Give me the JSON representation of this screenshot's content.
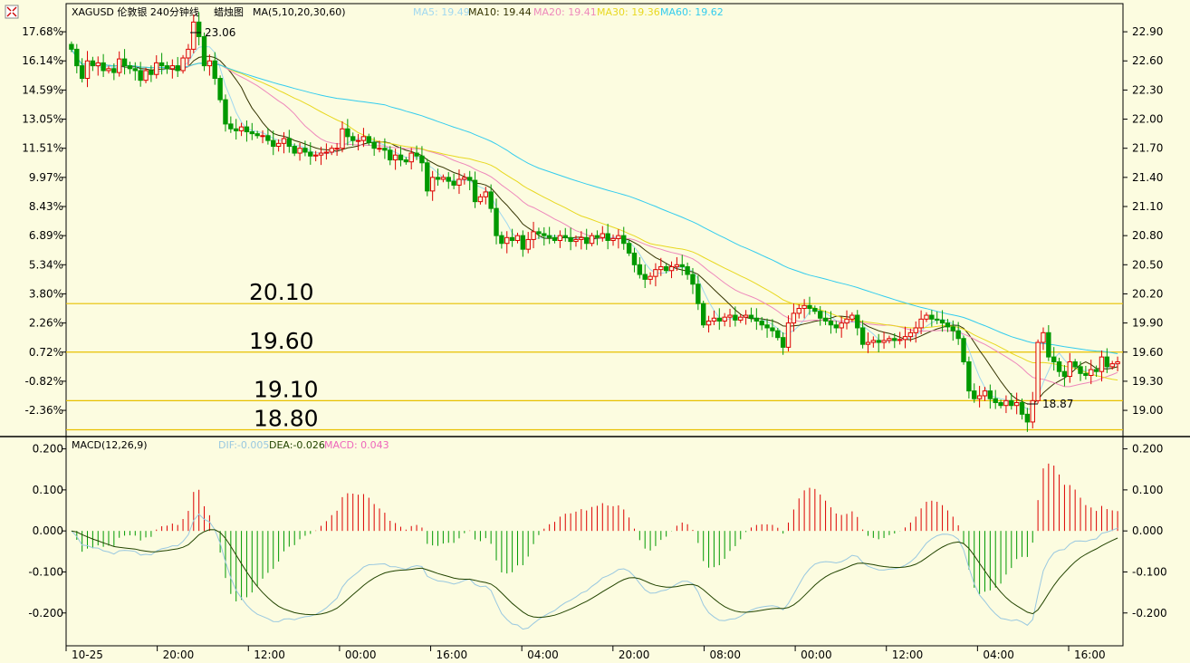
{
  "chart_data": {
    "type": "candlestick",
    "symbol_header": "XAGUSD 伦敦银 240分钟线",
    "chart_style": "蜡烛图",
    "ma_params": "MA(5,10,20,30,60)",
    "ma_legend": [
      {
        "label": "MA5: 19.49",
        "color": "#a0d8f0"
      },
      {
        "label": "MA10: 19.44",
        "color": "#333300"
      },
      {
        "label": "MA20: 19.41",
        "color": "#ee88bb"
      },
      {
        "label": "MA30: 19.36",
        "color": "#e8d820"
      },
      {
        "label": "MA60: 19.62",
        "color": "#33ccee"
      }
    ],
    "price_ticks": [
      "22.90",
      "22.60",
      "22.30",
      "22.00",
      "21.70",
      "21.40",
      "21.10",
      "20.80",
      "20.50",
      "20.20",
      "19.90",
      "19.60",
      "19.30",
      "19.00"
    ],
    "pct_ticks": [
      "17.68%",
      "16.14%",
      "14.59%",
      "13.05%",
      "11.51%",
      "9.97%",
      "8.43%",
      "6.89%",
      "5.34%",
      "3.80%",
      "2.26%",
      "0.72%",
      "-0.82%",
      "-2.36%"
    ],
    "price_range": [
      18.73,
      23.19
    ],
    "high_marker": "23.06",
    "low_marker": "18.87",
    "h_lines": [
      {
        "value": 20.1,
        "label": "20.10"
      },
      {
        "value": 19.6,
        "label": "19.60"
      },
      {
        "value": 19.1,
        "label": "19.10"
      },
      {
        "value": 18.8,
        "label": "18.80"
      }
    ],
    "x_ticks": [
      "10-25",
      "20:00",
      "12:00",
      "00:00",
      "16:00",
      "04:00",
      "20:00",
      "08:00",
      "00:00",
      "12:00",
      "04:00",
      "16:00"
    ],
    "closes": [
      22.72,
      22.55,
      22.42,
      22.6,
      22.55,
      22.58,
      22.5,
      22.52,
      22.48,
      22.62,
      22.55,
      22.52,
      22.5,
      22.4,
      22.5,
      22.46,
      22.58,
      22.55,
      22.52,
      22.55,
      22.5,
      22.63,
      22.72,
      23.0,
      22.85,
      22.55,
      22.6,
      22.42,
      22.2,
      21.95,
      21.9,
      21.88,
      21.92,
      21.87,
      21.85,
      21.83,
      21.83,
      21.78,
      21.72,
      21.75,
      21.8,
      21.72,
      21.65,
      21.7,
      21.66,
      21.62,
      21.63,
      21.65,
      21.66,
      21.7,
      21.7,
      21.9,
      21.82,
      21.78,
      21.78,
      21.82,
      21.76,
      21.7,
      21.7,
      21.68,
      21.58,
      21.63,
      21.58,
      21.56,
      21.65,
      21.62,
      21.55,
      21.26,
      21.4,
      21.38,
      21.4,
      21.36,
      21.32,
      21.38,
      21.4,
      21.37,
      21.15,
      21.2,
      21.25,
      21.08,
      20.8,
      20.72,
      20.78,
      20.75,
      20.8,
      20.66,
      20.76,
      20.84,
      20.82,
      20.8,
      20.78,
      20.75,
      20.8,
      20.78,
      20.74,
      20.76,
      20.78,
      20.72,
      20.8,
      20.78,
      20.82,
      20.75,
      20.77,
      20.8,
      20.72,
      20.62,
      20.5,
      20.4,
      20.35,
      20.38,
      20.45,
      20.48,
      20.44,
      20.48,
      20.5,
      20.48,
      20.4,
      20.3,
      20.1,
      19.88,
      19.92,
      19.95,
      19.92,
      19.96,
      19.98,
      19.93,
      19.96,
      19.98,
      19.95,
      19.92,
      19.88,
      19.85,
      19.82,
      19.75,
      19.65,
      19.9,
      20.0,
      20.05,
      20.08,
      20.05,
      20.02,
      19.95,
      19.92,
      19.88,
      19.85,
      19.9,
      19.94,
      19.98,
      19.85,
      19.68,
      19.7,
      19.72,
      19.7,
      19.72,
      19.74,
      19.72,
      19.73,
      19.76,
      19.8,
      19.85,
      19.94,
      19.98,
      19.94,
      19.93,
      19.9,
      19.86,
      19.82,
      19.74,
      19.5,
      19.2,
      19.12,
      19.15,
      19.2,
      19.12,
      19.08,
      19.05,
      19.1,
      19.05,
      19.08,
      18.96,
      18.88,
      19.1,
      19.7,
      19.8,
      19.55,
      19.5,
      19.4,
      19.35,
      19.5,
      19.45,
      19.38,
      19.36,
      19.42,
      19.4,
      19.55,
      19.45,
      19.48,
      19.5
    ]
  },
  "macd": {
    "label": "MACD(12,26,9)",
    "dif_label": "DIF:-0.005",
    "dea_label": "DEA:-0.026",
    "macd_label": "MACD: 0.043",
    "ticks": [
      "0.200",
      "0.100",
      "0.000",
      "-0.100",
      "-0.200"
    ],
    "range": [
      -0.28,
      0.23
    ]
  },
  "colors": {
    "background": "#fcfce0",
    "up": "#dd0000",
    "down": "#009900",
    "hline": "#e8c000",
    "dif": "#99c8e0",
    "dea": "#224400"
  }
}
